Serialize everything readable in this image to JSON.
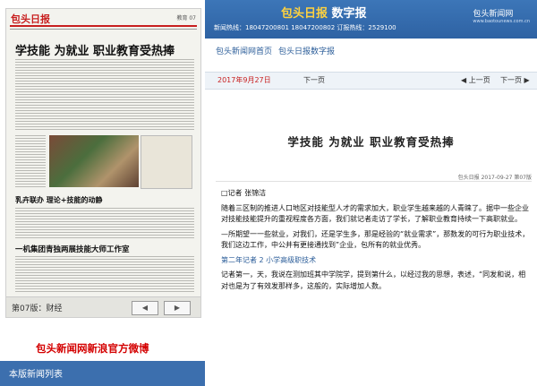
{
  "paper": {
    "masthead": "包头日报",
    "edition": "教育 07",
    "headline": "学技能 为就业 职业教育受热捧",
    "sub1": "乳卉联办 理论+技能的动静",
    "sub2": "一机集团青独两展技能大师工作室",
    "footer_label": "第07版：财经",
    "prev_arrow": "◀",
    "next_arrow": "▶"
  },
  "weibo": "包头新闻网新浪官方微博",
  "list_bar": "本版新闻列表",
  "banner": {
    "title_red": "包头日报",
    "title_white": "数字报",
    "info": "新闻热线：18047200801 18047200802 订报热线：2529100",
    "logo": "包头新闻网",
    "logo_sub": "www.baotounews.com.cn"
  },
  "tabs": [
    "包头新闻网首页",
    "包头日报数字报"
  ],
  "datebar": {
    "date": "2017年9月27日",
    "next": "下一页",
    "prev_btn": "◀ 上一页",
    "next_btn": "下一页 ▶"
  },
  "article": {
    "title": "学技能 为就业 职业教育受热捧",
    "meta": "包头日报 2017-09-27 第07版",
    "reporter": "□记者 张锦洁",
    "paragraphs": [
      "随着三区制的推进人口地区对技能型人才的需求加大，职业学生越来越的人青睐了。据中一些企业对技能技能提升的重视程度各方面，我们就记者走访了学长，了解职业教育持续一下高职就业。",
      "—所期望一一些就业，对我们，还是学生多，那是经验的“就业需求”，那数发的可行为职业技术，我们这边工作，中公并有更接通找到”企业，包所有的就业优秀。",
      "第二年记者 2 小学高级职技术",
      "记者第一，天，我说在测加班其中学院学，提到第什么，以经过我的思想，表述，“同发和说，相对也是为了有效发那样多，这般的，实际增加人数。"
    ]
  }
}
